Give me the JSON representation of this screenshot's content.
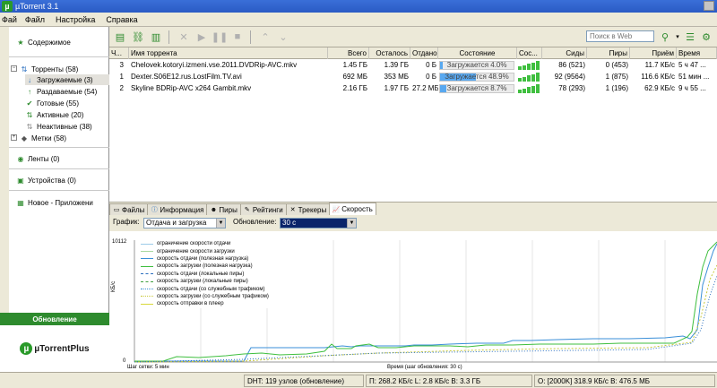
{
  "window": {
    "title": "µTorrent 3.1"
  },
  "menu": {
    "items": [
      "Фай",
      "Файл",
      "Настройка",
      "Справка"
    ]
  },
  "sidebar": {
    "content": "Содержимое",
    "torrents": "Торренты (58)",
    "downloading": "Загружаемые (3)",
    "seeding": "Раздаваемые (54)",
    "completed": "Готовые (55)",
    "active": "Активные (20)",
    "inactive": "Неактивные (38)",
    "labels": "Метки (58)",
    "feeds": "Ленты (0)",
    "devices": "Устройства (0)",
    "new_app": "Новое - Приложени",
    "update_button": "Обновление",
    "brand": "µTorrentPlus"
  },
  "toolbar": {
    "search_placeholder": "Поиск в Web"
  },
  "torrent_table": {
    "headers": [
      "Ч...",
      "Имя торрента",
      "Всего",
      "Осталось",
      "Отдано",
      "Состояние",
      "Сос...",
      "Сиды",
      "Пиры",
      "Приём",
      "Время"
    ],
    "rows": [
      {
        "num": "3",
        "name": "Chelovek.kotoryi.izmeni.vse.2011.DVDRip-AVC.mkv",
        "total": "1.45 ГБ",
        "left": "1.39 ГБ",
        "uploaded": "0 Б",
        "status": "Загружается 4.0%",
        "progress": 0.04,
        "health": 5,
        "seeds": "86 (521)",
        "peers": "0 (453)",
        "down": "11.7 КБ/с",
        "time": "5 ч 47 ..."
      },
      {
        "num": "1",
        "name": "Dexter.S06E12.rus.LostFilm.TV.avi",
        "total": "692 МБ",
        "left": "353 МБ",
        "uploaded": "0 Б",
        "status": "Загружается 48.9%",
        "progress": 0.489,
        "health": 5,
        "seeds": "92 (9564)",
        "peers": "1 (875)",
        "down": "116.6 КБ/с",
        "time": "51 мин ..."
      },
      {
        "num": "2",
        "name": "Skyline BDRip-AVC x264 Gambit.mkv",
        "total": "2.16 ГБ",
        "left": "1.97 ГБ",
        "uploaded": "27.2 МБ",
        "status": "Загружается 8.7%",
        "progress": 0.087,
        "health": 5,
        "seeds": "78 (293)",
        "peers": "1 (196)",
        "down": "62.9 КБ/с",
        "time": "9 ч 55 ..."
      }
    ]
  },
  "tabs": [
    "Файлы",
    "Информация",
    "Пиры",
    "Рейтинги",
    "Трекеры",
    "Скорость"
  ],
  "graph_controls": {
    "graph_label": "График:",
    "graph_value": "Отдача и загрузка",
    "update_label": "Обновление:",
    "update_value": "30 с"
  },
  "graph": {
    "ymax": "10112",
    "yzero": "0",
    "yunit": "КБ/с",
    "grid_step": "Шаг сетки: 5 мин",
    "time_label": "Время (шаг обновления: 30 с)",
    "legend": [
      {
        "label": "ограничение скорости отдачи",
        "color": "#9ccbe8",
        "style": "solid"
      },
      {
        "label": "ограничение скорости загрузки",
        "color": "#a8d8a0",
        "style": "solid"
      },
      {
        "label": "скорость отдачи (полезная нагрузка)",
        "color": "#3a8fd8",
        "style": "solid"
      },
      {
        "label": "скорость загрузки (полезная нагрузка)",
        "color": "#3fbf3f",
        "style": "solid"
      },
      {
        "label": "скорость отдачи (локальные пиры)",
        "color": "#2a6fbf",
        "style": "dashed"
      },
      {
        "label": "скорость загрузки (локальные пиры)",
        "color": "#3fa03f",
        "style": "dashed"
      },
      {
        "label": "скорость отдачи (со служебным трафиком)",
        "color": "#3a8fd8",
        "style": "dotted"
      },
      {
        "label": "скорость загрузки (со служебным трафиком)",
        "color": "#c8c83a",
        "style": "dotted"
      },
      {
        "label": "скорость отправки в плеер",
        "color": "#d8d83a",
        "style": "solid"
      }
    ]
  },
  "statusbar": {
    "dht": "DHT: 119 узлов  (обновление)",
    "download": "П: 268.2 КБ/с L: 2.8 КБ/с В: 3.3 ГБ",
    "upload": "О:  [2000K] 318.9 КБ/с В: 476.5 МБ"
  },
  "colors": {
    "accent": "#2e8b2e",
    "progress": "#58a8f0",
    "health": "#3fbf3f"
  }
}
